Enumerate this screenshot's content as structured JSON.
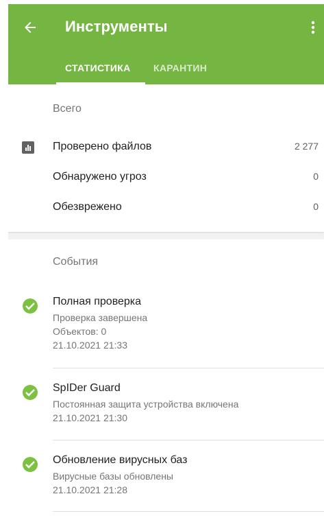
{
  "appbar": {
    "title": "Инструменты",
    "back_icon": "arrow-left-icon",
    "more_icon": "more-vert-icon",
    "color": "#75b642"
  },
  "tabs": [
    {
      "label": "СТАТИСТИКА",
      "active": true
    },
    {
      "label": "КАРАНТИН",
      "active": false
    }
  ],
  "totals": {
    "title": "Всего",
    "icon": "bar-chart-icon",
    "rows": [
      {
        "label": "Проверено файлов",
        "value": "2 277"
      },
      {
        "label": "Обнаружено угроз",
        "value": "0"
      },
      {
        "label": "Обезврежено",
        "value": "0"
      }
    ]
  },
  "events": {
    "title": "События",
    "icon": "check-circle-icon",
    "items": [
      {
        "title": "Полная проверка",
        "lines": [
          "Проверка завершена",
          "Объектов: 0",
          "21.10.2021 21:33"
        ]
      },
      {
        "title": "SpIDer Guard",
        "lines": [
          "Постоянная защита устройства включена",
          "21.10.2021 21:30"
        ]
      },
      {
        "title": "Обновление вирусных баз",
        "lines": [
          "Вирусные базы обновлены",
          "21.10.2021 21:28"
        ]
      }
    ]
  }
}
